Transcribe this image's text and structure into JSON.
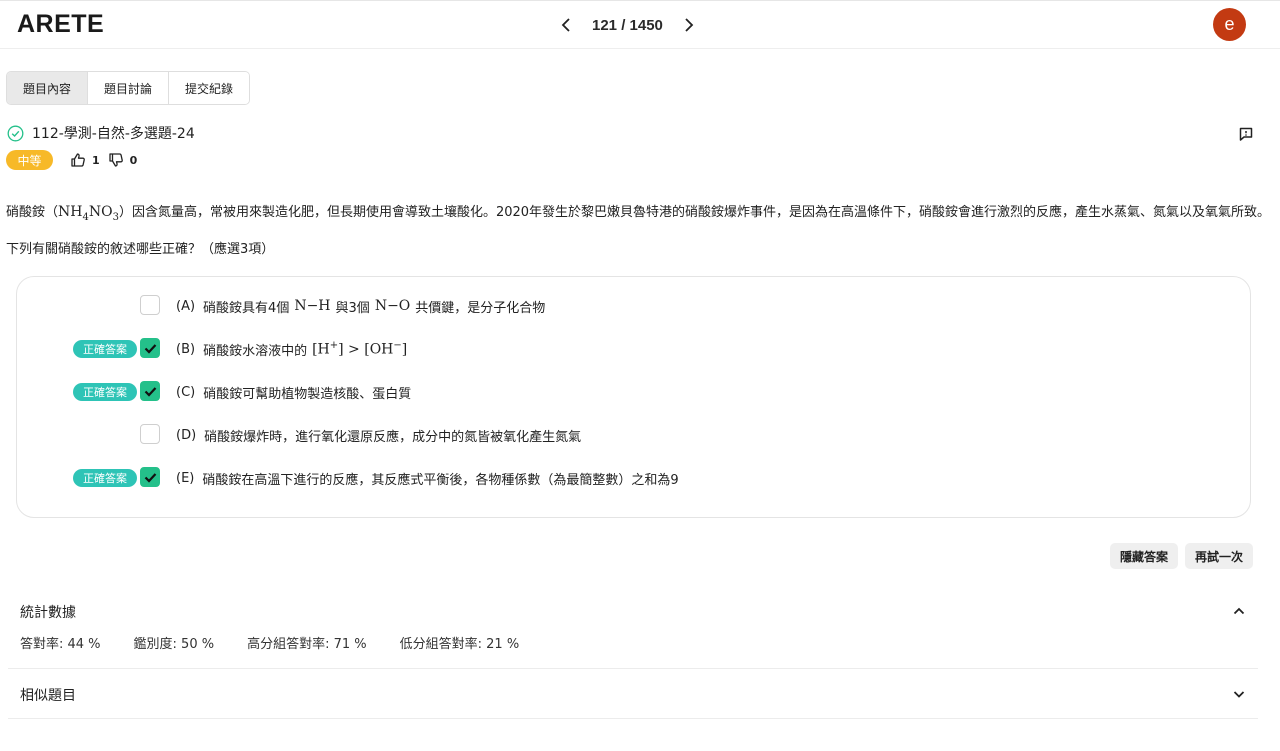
{
  "header": {
    "logo": "ARETE",
    "pager": "121 / 1450",
    "avatar_letter": "e"
  },
  "tabs": [
    {
      "label": "題目內容",
      "active": true
    },
    {
      "label": "題目討論",
      "active": false
    },
    {
      "label": "提交紀錄",
      "active": false
    }
  ],
  "question": {
    "title": "112-學測-自然-多選題-24",
    "difficulty": "中等",
    "likes": "1",
    "dislikes": "0",
    "stem_prefix": "硝酸銨（",
    "stem_after_formula": "）因含氮量高，常被用來製造化肥，但長期使用會導致土壤酸化。2020年發生於黎巴嫩貝魯特港的硝酸銨爆炸事件，是因為在高溫條件下，硝酸銨會進行激烈的反應，產生水蒸氣、氮氣以及氧氣所致。下列有關硝酸銨的敘述哪些正確？（應選3項）"
  },
  "options": {
    "correct_tag": "正確答案",
    "a": {
      "letter": "(A)",
      "t1": "硝酸銨具有4個",
      "t2": "與3個",
      "t3": "共價鍵，是分子化合物",
      "checked": false
    },
    "b": {
      "letter": "(B)",
      "t1": "硝酸銨水溶液中的",
      "checked": true
    },
    "c": {
      "letter": "(C)",
      "t1": "硝酸銨可幫助植物製造核酸、蛋白質",
      "checked": true
    },
    "d": {
      "letter": "(D)",
      "t1": "硝酸銨爆炸時，進行氧化還原反應，成分中的氮皆被氧化產生氮氣",
      "checked": false
    },
    "e": {
      "letter": "(E)",
      "t1": "硝酸銨在高溫下進行的反應，其反應式平衡後，各物種係數（為最簡整數）之和為9",
      "checked": true
    }
  },
  "buttons": {
    "hide": "隱藏答案",
    "retry": "再試一次"
  },
  "stats": {
    "title": "統計數據",
    "correct_rate": "答對率: 44 %",
    "discrimination": "鑑別度: 50 %",
    "high_group": "高分組答對率: 71 %",
    "low_group": "低分組答對率: 21 %"
  },
  "similar": {
    "title": "相似題目"
  },
  "colors": {
    "avatar": "#c33a12",
    "difficulty": "#f7b928",
    "correct_tag": "#2ec4b6",
    "checkbox": "#24c08a"
  }
}
